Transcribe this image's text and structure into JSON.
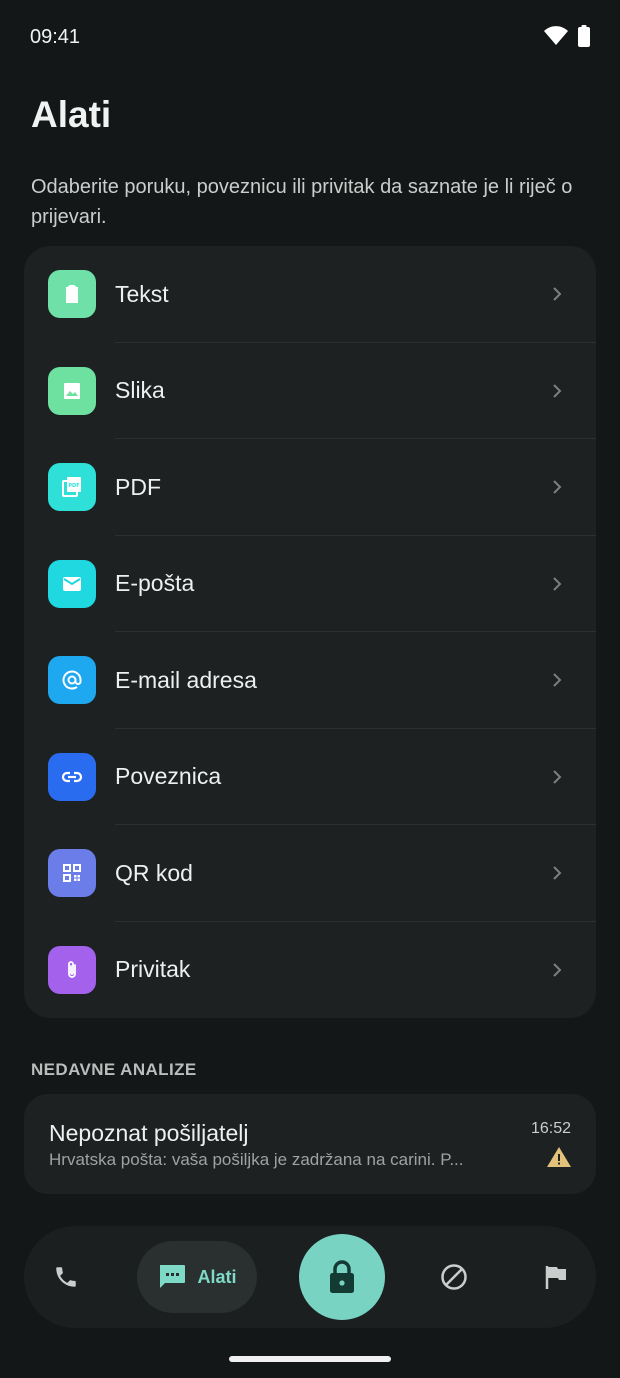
{
  "status_bar": {
    "time": "09:41"
  },
  "header": {
    "title": "Alati",
    "subtitle": "Odaberite poruku, poveznicu ili privitak da saznate je li riječ o prijevari."
  },
  "tools": [
    {
      "label": "Tekst",
      "icon": "clipboard-icon",
      "color": "#6fe0a8"
    },
    {
      "label": "Slika",
      "icon": "image-icon",
      "color": "#6ee0a0"
    },
    {
      "label": "PDF",
      "icon": "pdf-icon",
      "color": "#2ee0d8"
    },
    {
      "label": "E-pošta",
      "icon": "mail-icon",
      "color": "#1fd8e0"
    },
    {
      "label": "E-mail adresa",
      "icon": "at-icon",
      "color": "#1ea8f0"
    },
    {
      "label": "Poveznica",
      "icon": "link-icon",
      "color": "#2a6cf0"
    },
    {
      "label": "QR kod",
      "icon": "qr-icon",
      "color": "#6a7de8"
    },
    {
      "label": "Privitak",
      "icon": "paperclip-icon",
      "color": "#a461ec"
    }
  ],
  "recent": {
    "heading": "NEDAVNE ANALIZE",
    "items": [
      {
        "title": "Nepoznat pošiljatelj",
        "preview": "Hrvatska pošta: vaša pošiljka je zadržana na carini. P...",
        "time": "16:52",
        "status_icon": "warning-icon",
        "status_color": "#e2c27a"
      }
    ]
  },
  "bottom_nav": {
    "items": [
      {
        "icon": "phone-icon"
      },
      {
        "icon": "chat-icon",
        "label": "Alati",
        "active": true
      },
      {
        "icon": "lock-icon"
      },
      {
        "icon": "block-icon"
      },
      {
        "icon": "flag-icon"
      }
    ],
    "accent": "#79d3c2"
  }
}
